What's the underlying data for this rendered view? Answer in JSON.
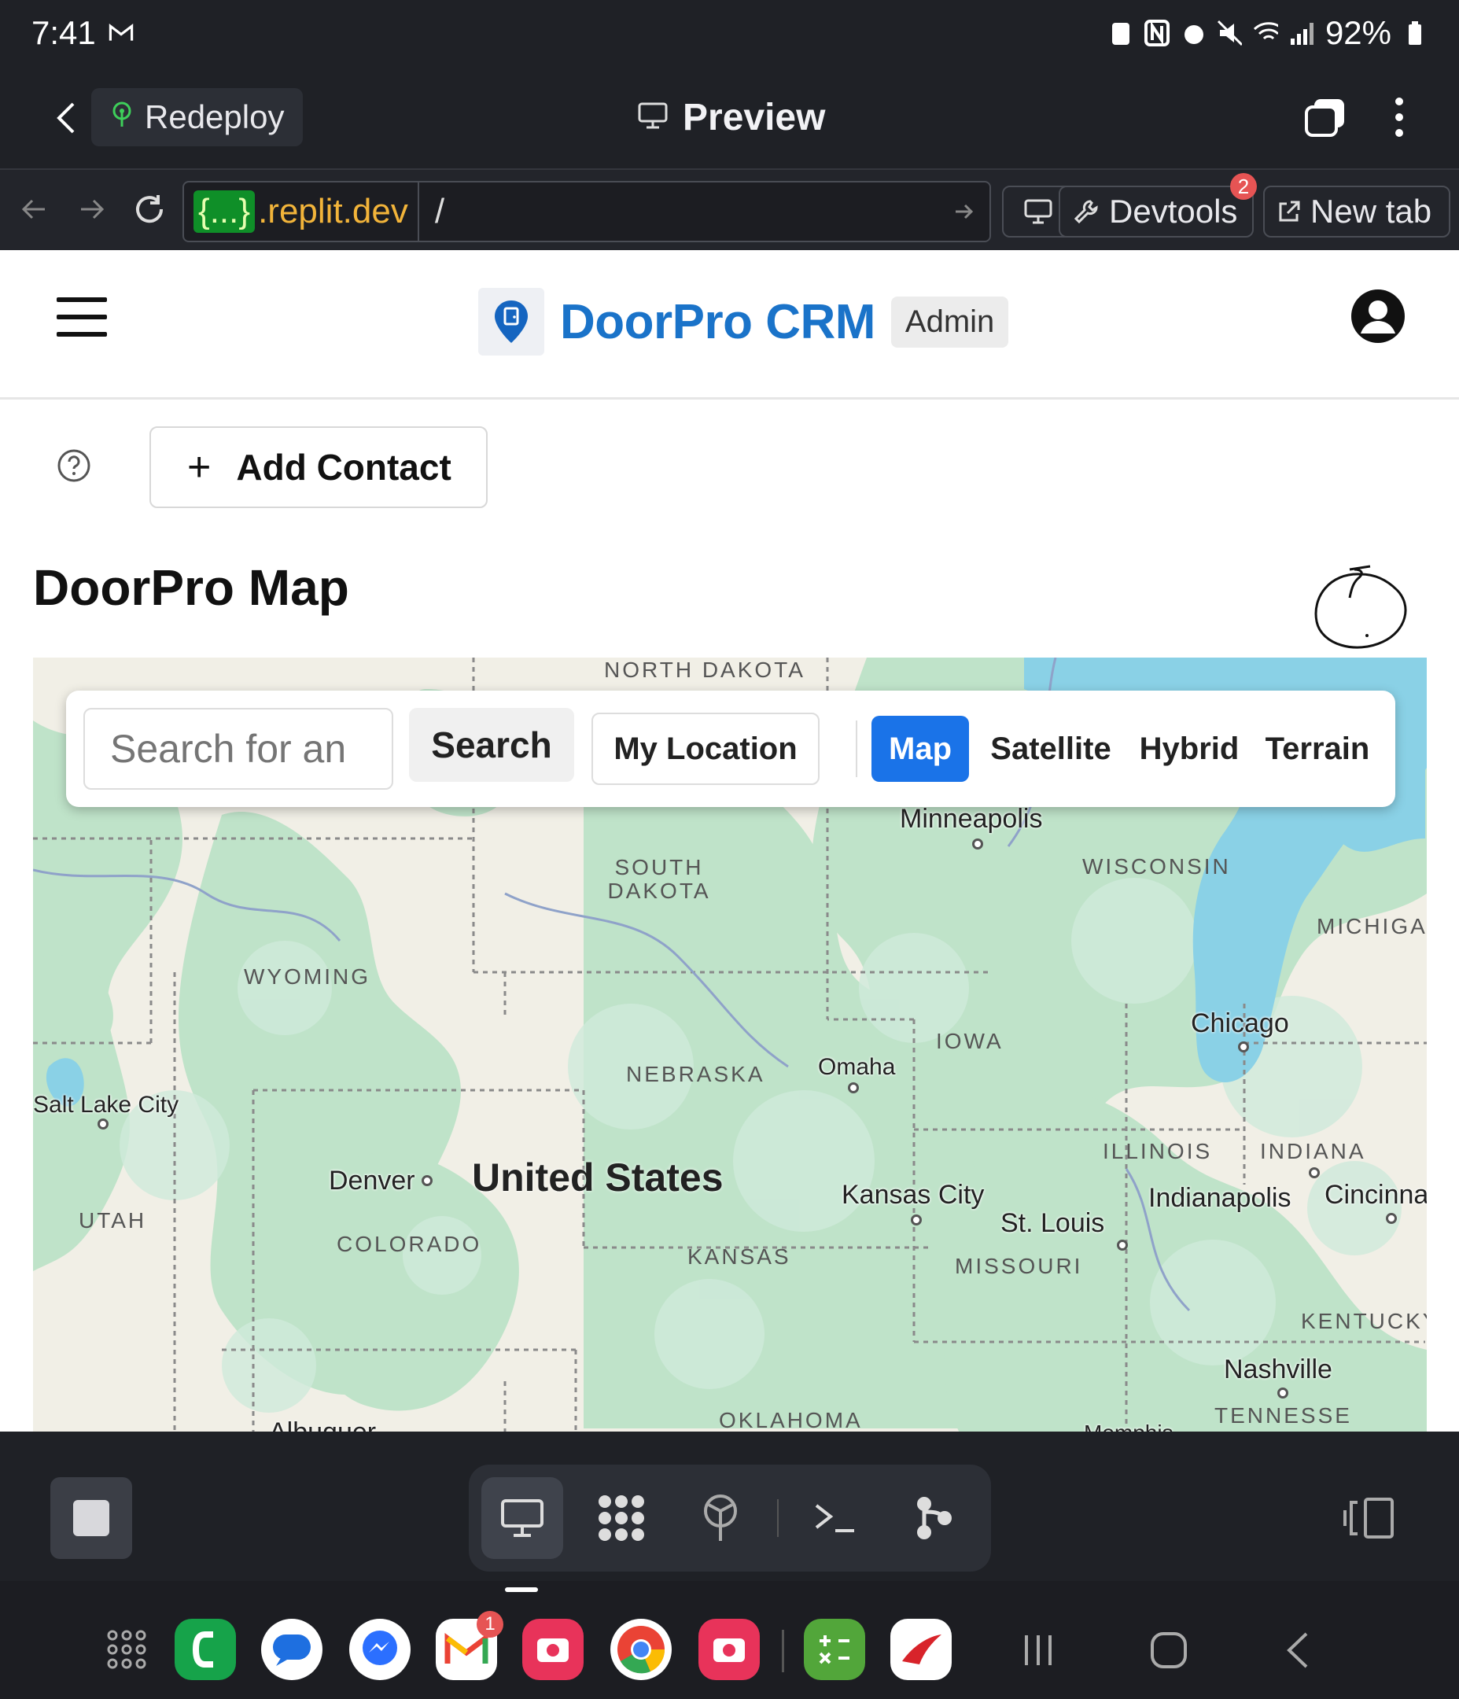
{
  "status_bar": {
    "time": "7:41",
    "battery": "92%"
  },
  "replit_header": {
    "redeploy_label": "Redeploy",
    "title": "Preview"
  },
  "url_bar": {
    "host_badge": "{...}",
    "host": ".replit.dev",
    "path": "/",
    "devtools_label": "Devtools",
    "devtools_badge": "2",
    "new_tab_label": "New tab"
  },
  "app": {
    "brand": "DoorPro CRM",
    "role_tag": "Admin",
    "add_contact_label": "Add Contact",
    "page_title": "DoorPro Map"
  },
  "map": {
    "search_placeholder": "Search for an",
    "search_button": "Search",
    "my_location_button": "My Location",
    "map_types": [
      "Map",
      "Satellite",
      "Hybrid",
      "Terrain"
    ],
    "active_map_type": "Map",
    "state_labels": [
      "NORTH DAKOTA",
      "SOUTH DAKOTA",
      "WYOMING",
      "NEBRASKA",
      "IOWA",
      "WISCONSIN",
      "MICHIGA",
      "ILLINOIS",
      "INDIANA",
      "UTAH",
      "COLORADO",
      "KANSAS",
      "MISSOURI",
      "KENTUCKY",
      "TENNESSE",
      "OKLAHOMA"
    ],
    "city_labels": [
      "Minneapolis",
      "Chicago",
      "Omaha",
      "Salt Lake City",
      "Denver",
      "Kansas City",
      "St. Louis",
      "Indianapolis",
      "Cincinna",
      "Nashville",
      "Albuquer",
      "Memphis"
    ],
    "country_label": "United States"
  },
  "android_nav": {
    "gmail_badge": "1"
  },
  "colors": {
    "brand_blue": "#1a73c9",
    "map_active": "#1a73e8",
    "replit_dark": "#1f2126"
  }
}
